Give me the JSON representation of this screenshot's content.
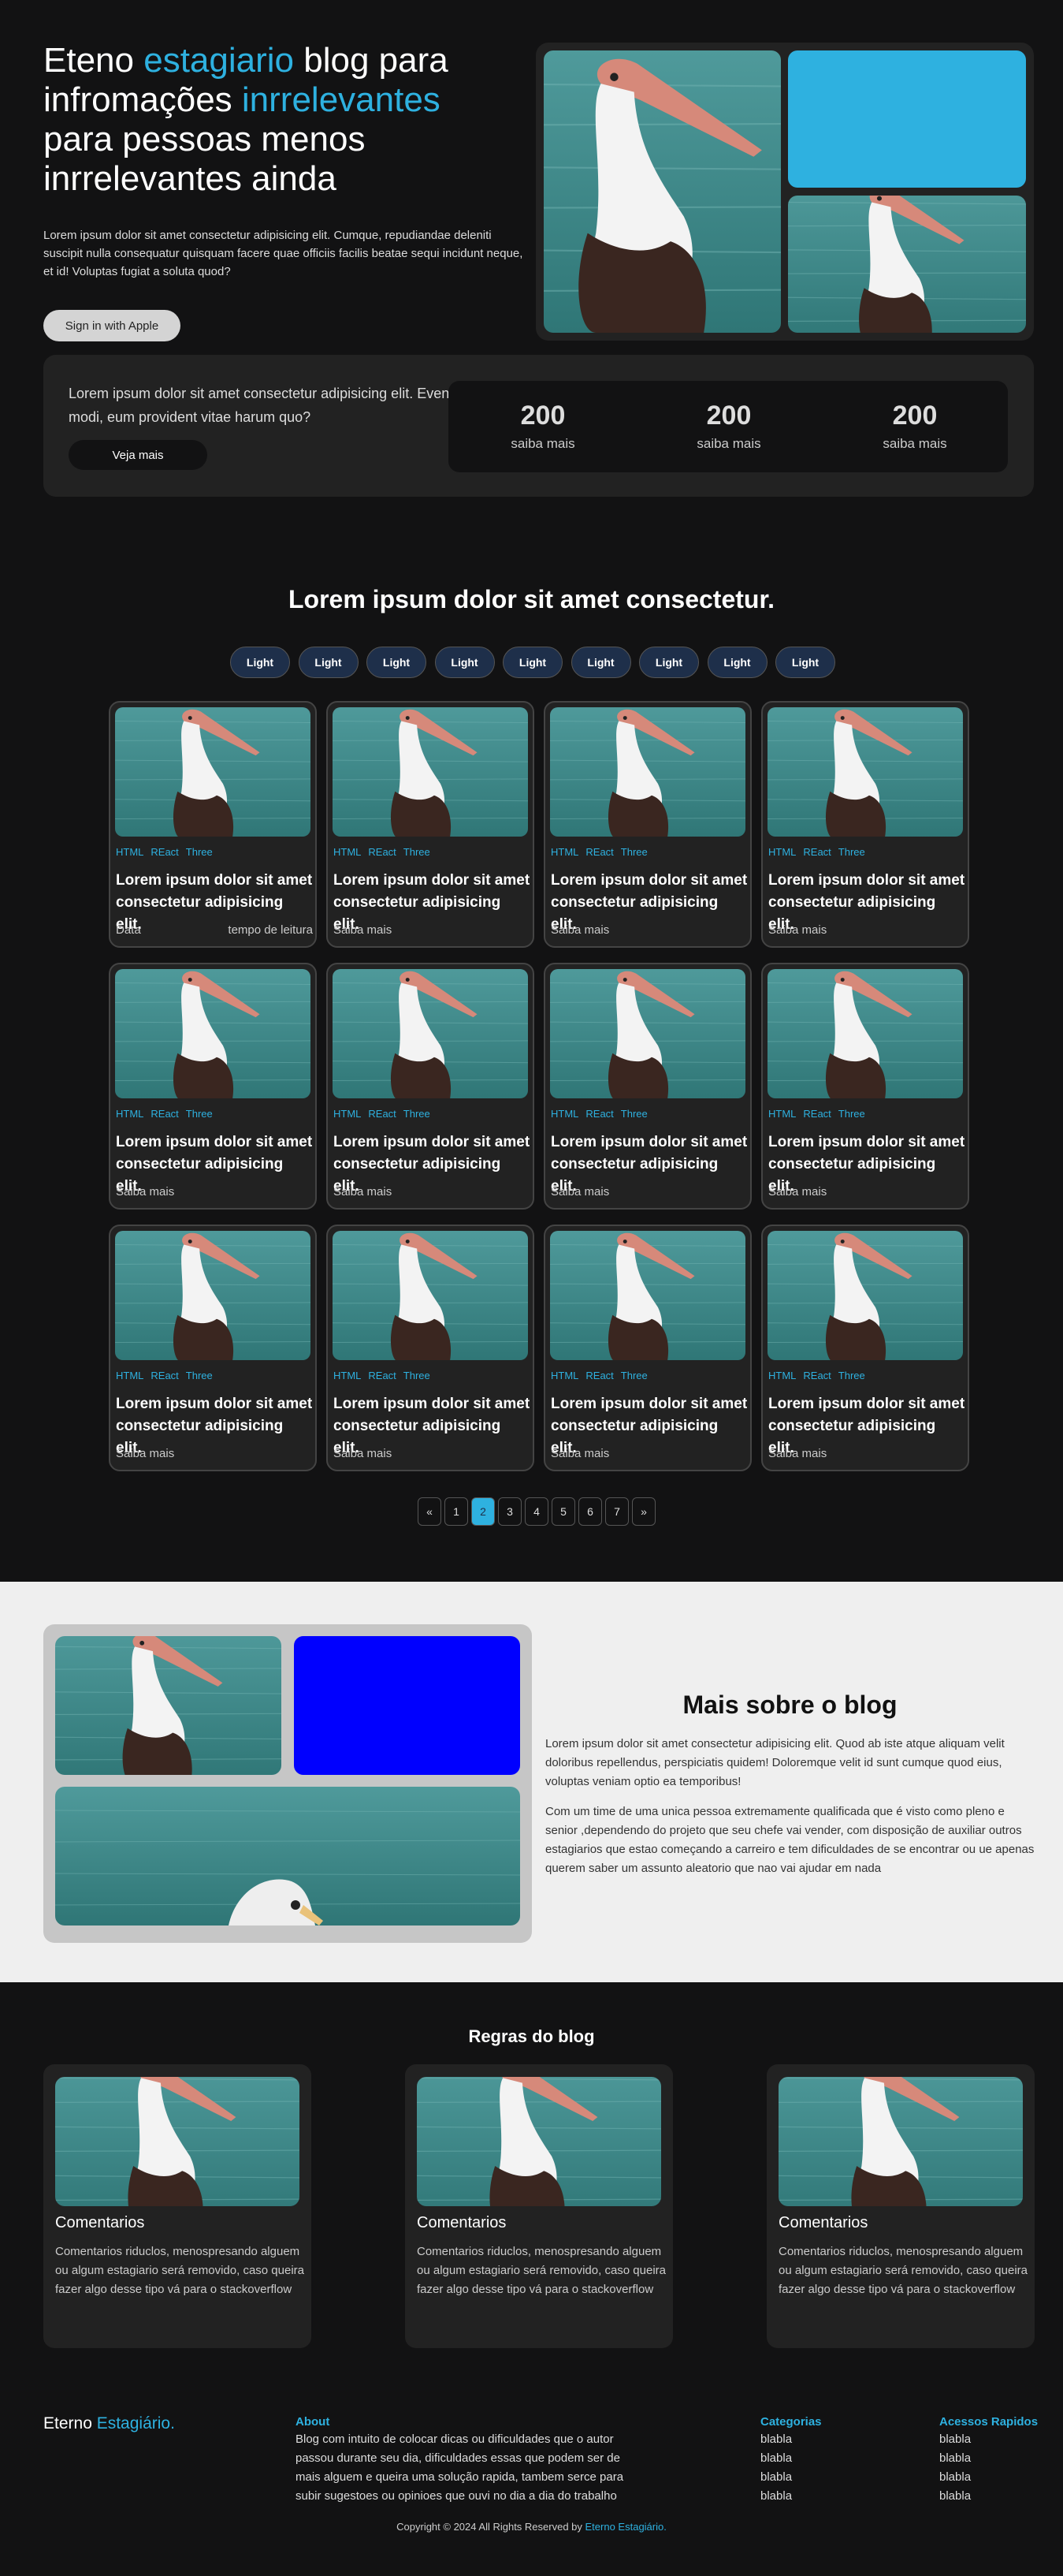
{
  "hero": {
    "title_part1": "Eteno ",
    "title_accent1": "estagiario",
    "title_part2": " blog para infromações ",
    "title_accent2": "inrrelevantes",
    "title_part3": " para pessoas menos inrrelevantes ainda",
    "description": "Lorem ipsum dolor sit amet consectetur adipisicing elit. Cumque, repudiandae deleniti suscipit nulla consequatur quisquam facere quae officiis facilis beatae sequi incidunt neque, et id! Voluptas fugiat a soluta quod?",
    "apple_button": "Sign in with Apple"
  },
  "stats": {
    "text": "Lorem ipsum dolor sit amet consectetur adipisicing elit. Eveniet modi, eum provident vitae harum quo?",
    "button": "Veja mais",
    "items": [
      {
        "value": "200",
        "label": "saiba mais"
      },
      {
        "value": "200",
        "label": "saiba mais"
      },
      {
        "value": "200",
        "label": "saiba mais"
      }
    ]
  },
  "posts": {
    "title": "Lorem ipsum dolor sit amet consectetur.",
    "filters": [
      "Light",
      "Light",
      "Light",
      "Light",
      "Light",
      "Light",
      "Light",
      "Light",
      "Light"
    ],
    "card_tags": [
      "HTML",
      "REact",
      "Three"
    ],
    "card_title": "Lorem ipsum dolor sit amet consectetur adipisicing elit.",
    "first_card_left": "Data",
    "first_card_right": "tempo de leitura",
    "card_footer": "Saiba mais"
  },
  "pagination": [
    "«",
    "1",
    "2",
    "3",
    "4",
    "5",
    "6",
    "7",
    "»"
  ],
  "pagination_active": "2",
  "about": {
    "title": "Mais sobre o blog",
    "p1": "Lorem ipsum dolor sit amet consectetur adipisicing elit. Quod ab iste atque aliquam velit doloribus repellendus, perspiciatis quidem! Doloremque velit id sunt cumque quod eius, voluptas veniam optio ea temporibus!",
    "p2": "Com um time de uma unica pessoa extremamente qualificada que é visto como pleno e senior ,dependendo do projeto que seu chefe vai vender, com disposição de auxiliar outros estagiarios que estao começando a carreiro e tem dificuldades de se encontrar ou ue apenas querem saber um assunto aleatorio que nao vai ajudar em nada"
  },
  "rules": {
    "title": "Regras do blog",
    "items": [
      {
        "title": "Comentarios",
        "text": "Comentarios riduclos, menospresando alguem ou algum estagiario será removido, caso queira fazer algo desse tipo vá para o stackoverflow"
      },
      {
        "title": "Comentarios",
        "text": "Comentarios riduclos, menospresando alguem ou algum estagiario será removido, caso queira fazer algo desse tipo vá para o stackoverflow"
      },
      {
        "title": "Comentarios",
        "text": "Comentarios riduclos, menospresando alguem ou algum estagiario será removido, caso queira fazer algo desse tipo vá para o stackoverflow"
      }
    ]
  },
  "footer": {
    "logo_part1": "Eterno ",
    "logo_accent": "Estagiário.",
    "about_title": "About",
    "about_text": "Blog com intuito de colocar dicas ou dificuldades que o autor passou durante seu dia, dificuldades essas que podem ser de mais alguem e queira uma solução rapida, tambem serce para subir sugestoes ou opinioes que ouvi no dia a dia do trabalho",
    "categories_title": "Categorias",
    "categories": [
      "blabla",
      "blabla",
      "blabla",
      "blabla"
    ],
    "quick_title": "Acessos Rapidos",
    "quick": [
      "blabla",
      "blabla",
      "blabla",
      "blabla"
    ],
    "copyright": "Copyright © 2024 All Rights Reserved by ",
    "copyright_link": "Eterno Estagiário."
  },
  "colors": {
    "accent": "#2eb1e0",
    "background": "#121213",
    "card": "#222222",
    "blue_block": "#0000ff",
    "light_block": "#2eb1e0"
  },
  "icons": {
    "image": "pelican-photo"
  }
}
